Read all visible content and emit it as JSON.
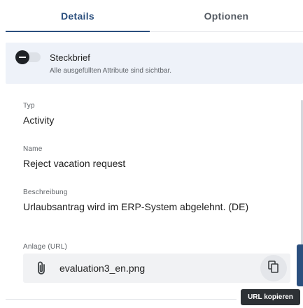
{
  "tabs": [
    {
      "label": "Details",
      "active": true
    },
    {
      "label": "Optionen",
      "active": false
    }
  ],
  "steckbrief": {
    "title": "Steckbrief",
    "subtitle": "Alle ausgefüllten Attribute sind sichtbar.",
    "toggle_on": false
  },
  "fields": {
    "typ": {
      "label": "Typ",
      "value": "Activity"
    },
    "name": {
      "label": "Name",
      "value": "Reject vacation request"
    },
    "beschreibung": {
      "label": "Beschreibung",
      "value": "Urlaubsantrag wird im ERP-System abgelehnt. (DE)"
    },
    "anlage": {
      "label": "Anlage (URL)",
      "value": "evaluation3_en.png"
    }
  },
  "tooltip": {
    "text": "URL kopieren"
  },
  "icons": {
    "attachment": "paperclip-icon",
    "copy": "copy-icon"
  },
  "colors": {
    "accent": "#2b4f7e",
    "panel": "#eef2f9",
    "tooltip_bg": "#2d3135"
  }
}
